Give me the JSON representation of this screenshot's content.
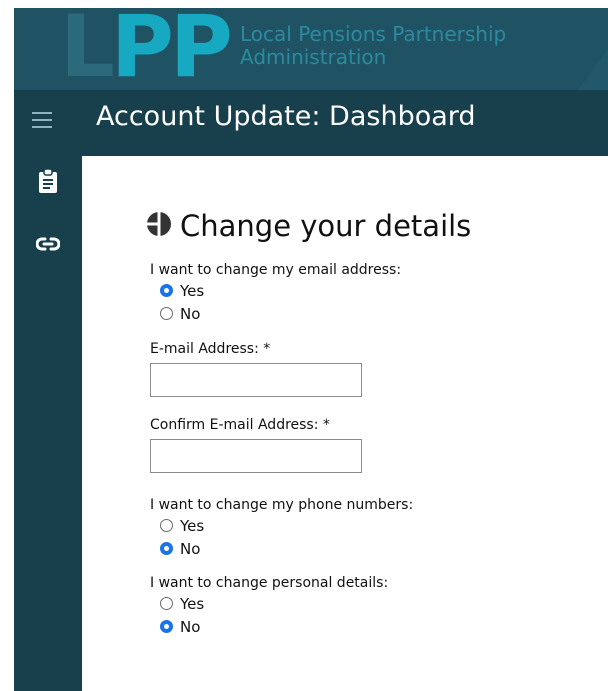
{
  "brand": {
    "letters_l": "L",
    "letters_pp": "PP",
    "line1": "Local Pensions Partnership",
    "line2": "Administration"
  },
  "header": {
    "title": "Account Update: Dashboard"
  },
  "sidebar": {
    "icons": [
      "menu-icon",
      "clipboard-icon",
      "link-icon"
    ]
  },
  "section": {
    "heading": "Change your details"
  },
  "form": {
    "email_change": {
      "question": "I want to change my email address:",
      "yes_label": "Yes",
      "no_label": "No",
      "selected": "Yes"
    },
    "email_field": {
      "label": "E-mail Address: *",
      "value": ""
    },
    "confirm_email_field": {
      "label": "Confirm E-mail Address: *",
      "value": ""
    },
    "phone_change": {
      "question": "I want to change my phone numbers:",
      "yes_label": "Yes",
      "no_label": "No",
      "selected": "No"
    },
    "personal_change": {
      "question": "I want to change personal details:",
      "yes_label": "Yes",
      "no_label": "No",
      "selected": "No"
    }
  },
  "colors": {
    "header_bg": "#1f5363",
    "nav_bg": "#173f4c",
    "logo_accent": "#17a9c2",
    "radio_checked": "#1a73e8"
  }
}
